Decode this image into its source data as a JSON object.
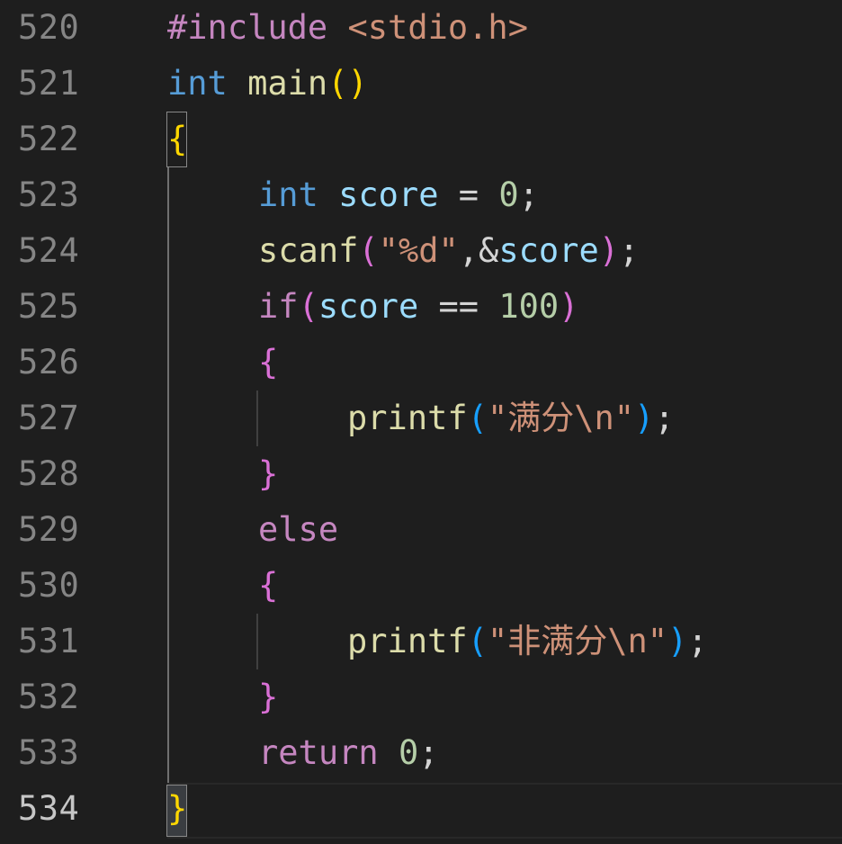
{
  "editor": {
    "line_numbers": [
      "520",
      "521",
      "522",
      "523",
      "524",
      "525",
      "526",
      "527",
      "528",
      "529",
      "530",
      "531",
      "532",
      "533",
      "534"
    ],
    "code": {
      "l520": {
        "directive": "#include",
        "sp": " ",
        "header": "<stdio.h>"
      },
      "l521": {
        "type": "int",
        "sp": " ",
        "name": "main",
        "paren": "()"
      },
      "l522": {
        "brace": "{"
      },
      "l523": {
        "type": "int",
        "sp": " ",
        "var": "score",
        "op": " = ",
        "num": "0",
        "semi": ";"
      },
      "l524": {
        "fn": "scanf",
        "lp": "(",
        "str": "\"%d\"",
        "comma": ",&",
        "var": "score",
        "rp": ")",
        "semi": ";"
      },
      "l525": {
        "kw": "if",
        "lp": "(",
        "var": "score",
        "op": " == ",
        "num": "100",
        "rp": ")"
      },
      "l526": {
        "brace": "{"
      },
      "l527": {
        "fn": "printf",
        "lp": "(",
        "str": "\"满分\\n\"",
        "rp": ")",
        "semi": ";"
      },
      "l528": {
        "brace": "}"
      },
      "l529": {
        "kw": "else"
      },
      "l530": {
        "brace": "{"
      },
      "l531": {
        "fn": "printf",
        "lp": "(",
        "str": "\"非满分\\n\"",
        "rp": ")",
        "semi": ";"
      },
      "l532": {
        "brace": "}"
      },
      "l533": {
        "kw": "return",
        "sp": " ",
        "num": "0",
        "semi": ";"
      },
      "l534": {
        "brace": "}"
      }
    },
    "theme": {
      "background": "#1e1e1e",
      "keyword": "#c586c0",
      "type": "#569cd6",
      "variable": "#9cdcfe",
      "function": "#dcdcaa",
      "string": "#ce9178",
      "number": "#b5cea8",
      "bracket_level1": "#ffd700",
      "bracket_level2": "#da70d6",
      "bracket_level3": "#179fff"
    }
  }
}
